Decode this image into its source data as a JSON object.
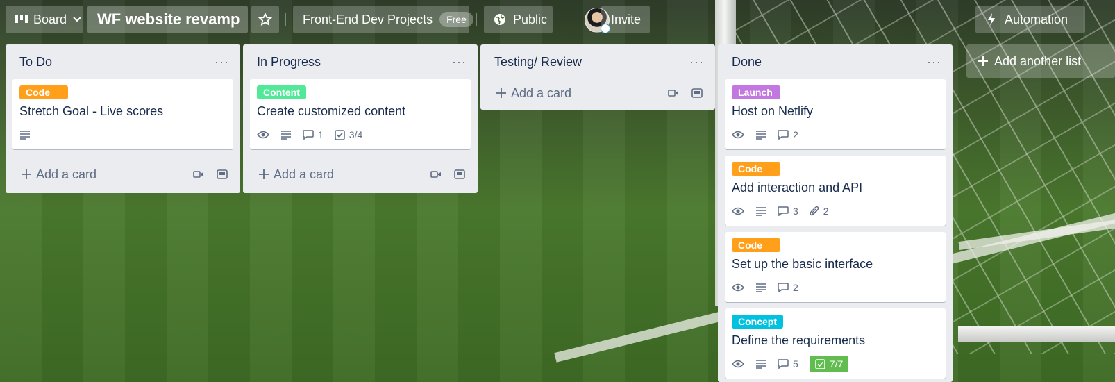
{
  "header": {
    "board_view_label": "Board",
    "board_title": "WF website revamp",
    "workspace_name": "Front-End Dev Projects",
    "workspace_plan": "Free",
    "visibility": "Public",
    "invite_label": "Invite",
    "automation_label": "Automation"
  },
  "lists": [
    {
      "title": "To Do",
      "cards": [
        {
          "label": "Code",
          "label_color": "#ff9f1a",
          "title": "Stretch Goal - Live scores"
        }
      ],
      "add_card_label": "Add a card"
    },
    {
      "title": "In Progress",
      "cards": [
        {
          "label": "Content",
          "label_color": "#51e898",
          "title": "Create customized content",
          "comments": "1",
          "checklist": "3/4"
        }
      ],
      "add_card_label": "Add a card"
    },
    {
      "title": "Testing/ Review",
      "cards": [],
      "add_card_label": "Add a card"
    },
    {
      "title": "Done",
      "cards": [
        {
          "label": "Launch",
          "label_color": "#c377e0",
          "title": "Host on Netlify",
          "comments": "2"
        },
        {
          "label": "Code",
          "label_color": "#ff9f1a",
          "title": "Add interaction and API",
          "comments": "3",
          "attachments": "2"
        },
        {
          "label": "Code",
          "label_color": "#ff9f1a",
          "title": "Set up the basic interface",
          "comments": "2"
        },
        {
          "label": "Concept",
          "label_color": "#00c2e0",
          "title": "Define the requirements",
          "comments": "5",
          "checklist": "7/7"
        }
      ]
    }
  ],
  "add_list_label": "Add another list",
  "icons": {
    "board": "board-icon",
    "chevron": "chevron-down-icon",
    "star": "star-icon",
    "globe": "globe-icon",
    "automation": "lightning-icon",
    "watch": "eye-icon",
    "description": "description-icon",
    "comment": "comment-icon",
    "checklist": "checklist-icon",
    "attachment": "paperclip-icon",
    "template": "card-template-icon",
    "plus": "plus-icon"
  },
  "colors": {
    "done_badge": "#61bd4f",
    "list_bg": "#ebecf0"
  }
}
